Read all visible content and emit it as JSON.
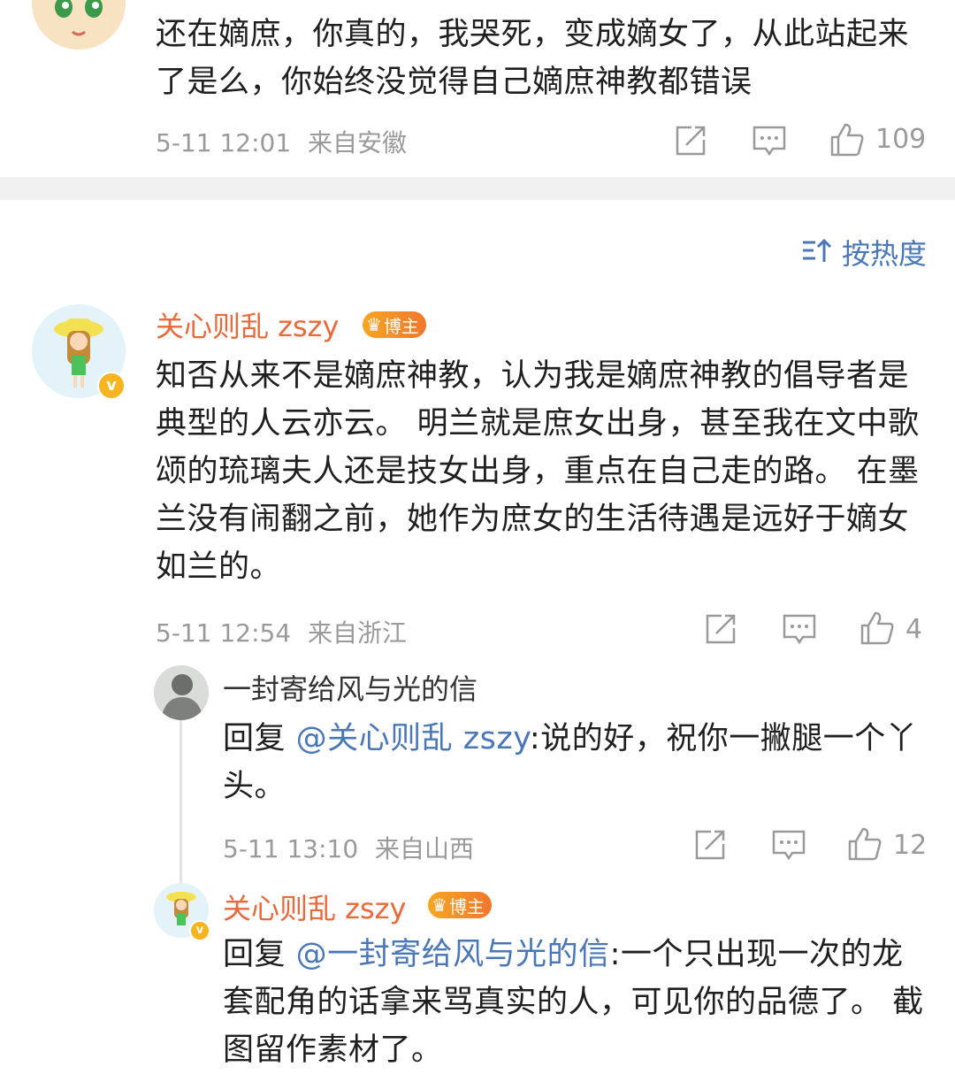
{
  "top_comment": {
    "text": "还在嫡庶，你真的，我哭死，变成嫡女了，从此站起来了是么，你始终没觉得自己嫡庶神教都错误",
    "time": "5-11 12:01",
    "location": "来自安徽",
    "likes": "109"
  },
  "sort": {
    "label": "按热度",
    "icon": "sort-icon"
  },
  "main_comment": {
    "author": "关心则乱 zszy",
    "badge": "博主",
    "text": "知否从来不是嫡庶神教，认为我是嫡庶神教的倡导者是典型的人云亦云。 明兰就是庶女出身，甚至我在文中歌颂的琉璃夫人还是技女出身，重点在自己走的路。 在墨兰没有闹翻之前，她作为庶女的生活待遇是远好于嫡女如兰的。",
    "time": "5-11 12:54",
    "location": "来自浙江",
    "likes": "4"
  },
  "reply1": {
    "author": "一封寄给风与光的信",
    "reply_prefix": "回复 ",
    "mention": "@关心则乱 zszy",
    "text": ":说的好，祝你一撇腿一个丫头。",
    "time": "5-11 13:10",
    "location": "来自山西",
    "likes": "12"
  },
  "reply2": {
    "author": "关心则乱 zszy",
    "badge": "博主",
    "reply_prefix": "回复 ",
    "mention": "@一封寄给风与光的信",
    "text": ":一个只出现一次的龙套配角的话拿来骂真实的人，可见你的品德了。 截图留作素材了。"
  },
  "colors": {
    "author": "#e8693a",
    "link": "#4a77b8",
    "meta": "#9a9a9a",
    "badge": "#f0772d"
  }
}
